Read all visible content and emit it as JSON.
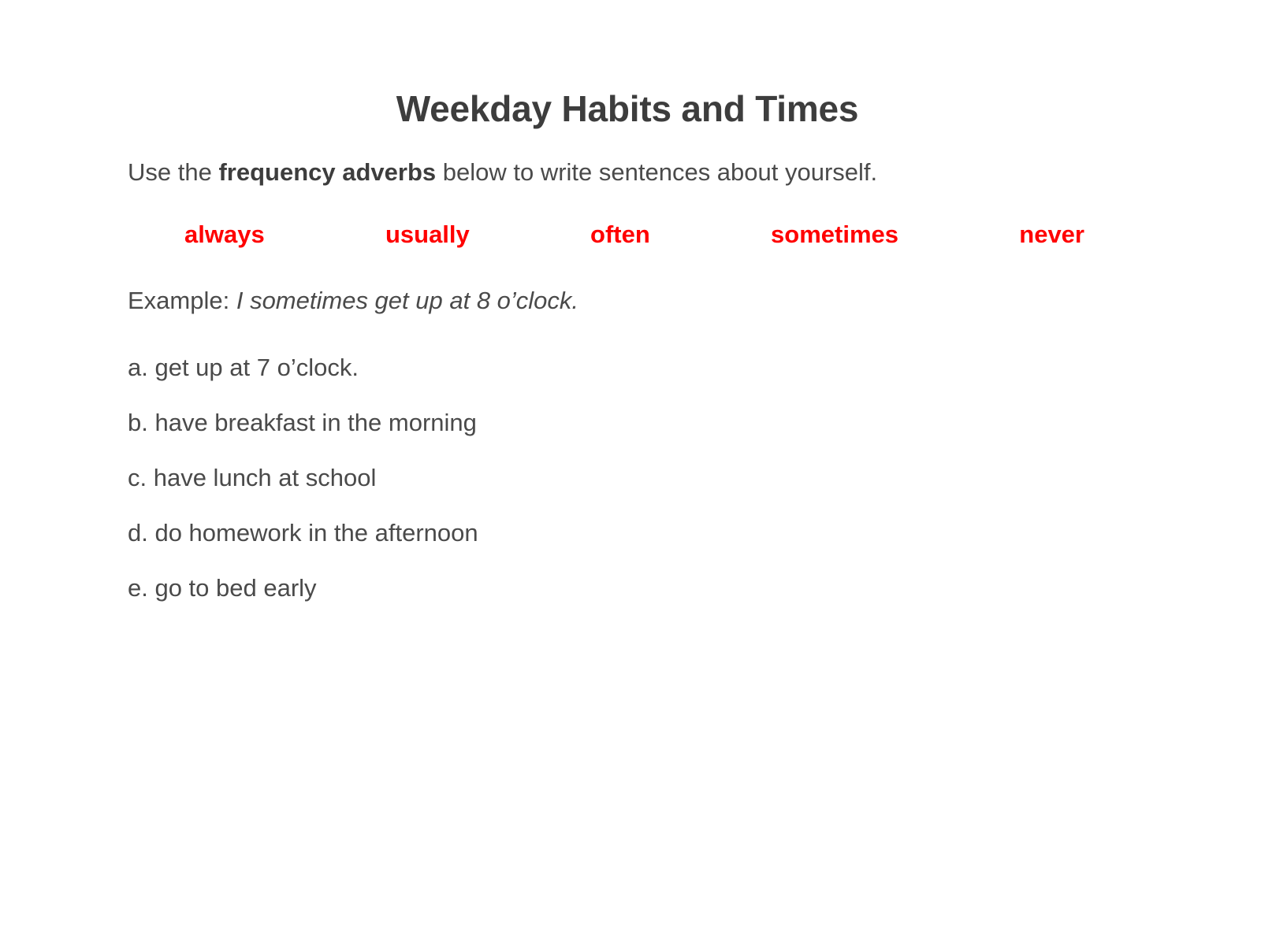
{
  "worksheet": {
    "title": "Weekday Habits and Times",
    "instruction": {
      "before": "Use the ",
      "bold": "frequency adverbs",
      "after": " below to write sentences about yourself."
    },
    "adverbs": [
      "always",
      "usually",
      "often",
      "sometimes",
      "never"
    ],
    "example": {
      "label": "Example: ",
      "sentence": "I sometimes get up at 8 o’clock."
    },
    "items": [
      "a. get up at 7 o’clock.",
      "b. have breakfast in the morning",
      "c. have lunch at school",
      "d. do homework in the afternoon",
      "e. go to bed early"
    ],
    "colors": {
      "background": "#ffffff",
      "title": "#3d3d3d",
      "body": "#4a4a4a",
      "adverb": "#ff0000"
    }
  }
}
